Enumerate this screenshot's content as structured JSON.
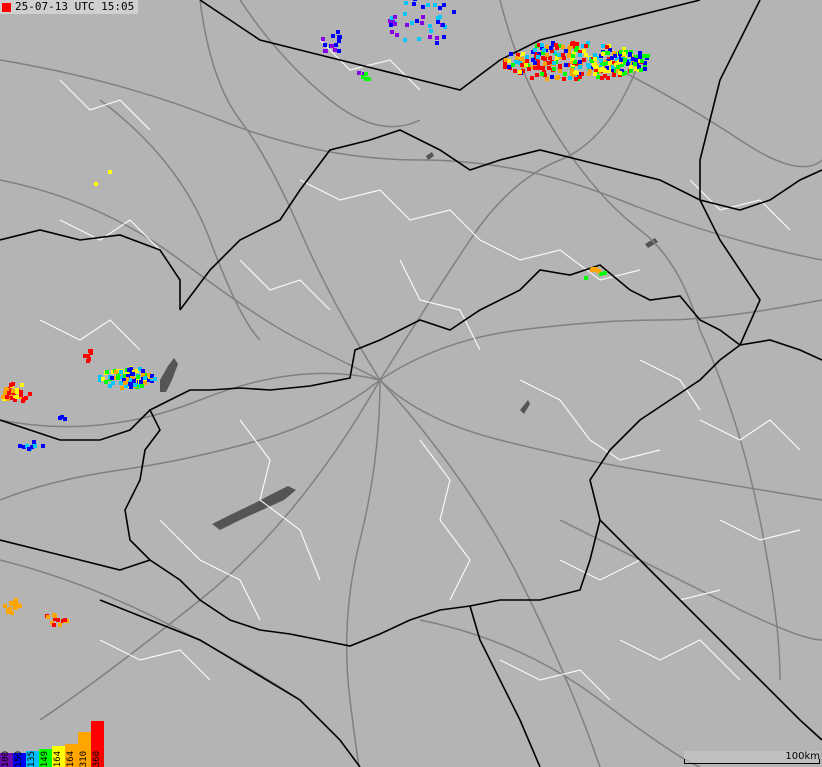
{
  "header": {
    "timestamp": "25-07-13 UTC 15:05"
  },
  "legend": {
    "items": [
      {
        "label": "100",
        "color": "#6a0dad"
      },
      {
        "label": "150",
        "color": "#0000ff"
      },
      {
        "label": "135",
        "color": "#00bfff"
      },
      {
        "label": "149",
        "color": "#00ff00"
      },
      {
        "label": "164",
        "color": "#ffff00"
      },
      {
        "label": "164",
        "color": "#ffa500"
      },
      {
        "label": "310",
        "color": "#ffa500"
      },
      {
        "label": "360",
        "color": "#ff0000"
      }
    ],
    "levels": [
      0.3,
      0.3,
      0.35,
      0.4,
      0.45,
      0.5,
      0.75,
      1.0
    ]
  },
  "scale_bar": {
    "label": "100km"
  },
  "colors": {
    "land": "#b4b4b4",
    "country_border": "#000000",
    "admin_border": "#ffffff",
    "roads": "#7a7a7a",
    "water": "#555555"
  },
  "lightning_colors": [
    "#8a00e6",
    "#0000ff",
    "#00c8ff",
    "#00ff00",
    "#ffff00",
    "#ffa500",
    "#ff0000"
  ]
}
